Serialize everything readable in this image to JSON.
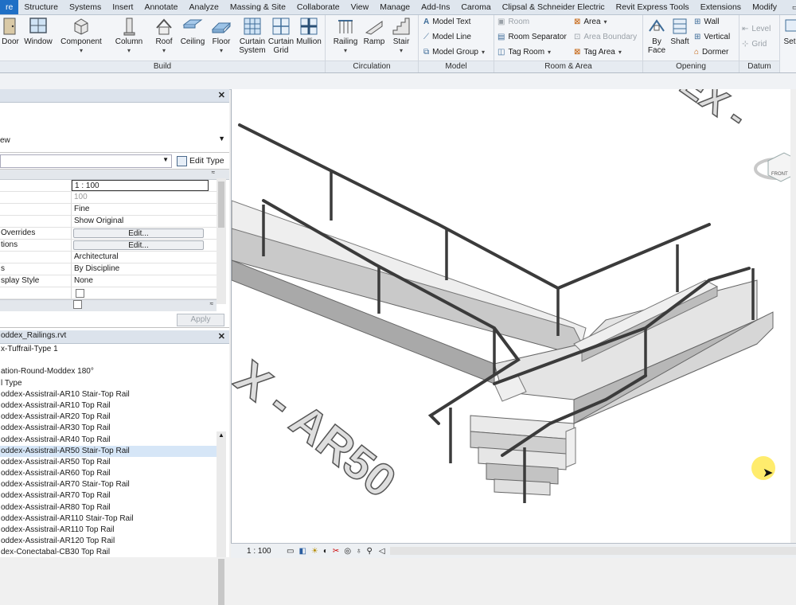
{
  "ribbon_tabs": [
    "re",
    "Structure",
    "Systems",
    "Insert",
    "Annotate",
    "Analyze",
    "Massing & Site",
    "Collaborate",
    "View",
    "Manage",
    "Add-Ins",
    "Caroma",
    "Clipsal & Schneider Electric",
    "Revit Express Tools",
    "Extensions",
    "Modify"
  ],
  "active_tab_index": 0,
  "build": {
    "title": "Build",
    "tools": [
      {
        "label": "Door",
        "icon": "door-icon"
      },
      {
        "label": "Window",
        "icon": "window-icon"
      },
      {
        "label": "Component",
        "icon": "component-icon"
      },
      {
        "label": "Column",
        "icon": "column-icon"
      },
      {
        "label": "Roof",
        "icon": "roof-icon"
      },
      {
        "label": "Ceiling",
        "icon": "ceiling-icon"
      },
      {
        "label": "Floor",
        "icon": "floor-icon"
      },
      {
        "label": "Curtain System",
        "icon": "curtain-system-icon"
      },
      {
        "label": "Curtain Grid",
        "icon": "curtain-grid-icon"
      },
      {
        "label": "Mullion",
        "icon": "mullion-icon"
      }
    ]
  },
  "circulation": {
    "title": "Circulation",
    "tools": [
      {
        "label": "Railing"
      },
      {
        "label": "Ramp"
      },
      {
        "label": "Stair"
      }
    ]
  },
  "model": {
    "title": "Model",
    "tools": [
      {
        "label": "Model Text"
      },
      {
        "label": "Model Line"
      },
      {
        "label": "Model Group"
      }
    ]
  },
  "room_area": {
    "title": "Room & Area",
    "tools": [
      {
        "label": "Room",
        "disabled": true
      },
      {
        "label": "Room Separator",
        "disabled": false
      },
      {
        "label": "Tag Room",
        "disabled": false
      },
      {
        "label": "Area",
        "disabled": false
      },
      {
        "label": "Area Boundary",
        "disabled": true
      },
      {
        "label": "Tag Area",
        "disabled": false
      }
    ]
  },
  "opening": {
    "title": "Opening",
    "tools": [
      {
        "label": "By Face"
      },
      {
        "label": "Shaft"
      },
      {
        "label": "Wall"
      },
      {
        "label": "Vertical"
      },
      {
        "label": "Dormer"
      }
    ]
  },
  "datum": {
    "title": "Datum",
    "tools": [
      {
        "label": "Level",
        "disabled": true
      },
      {
        "label": "Grid",
        "disabled": true
      }
    ]
  },
  "work_plane": {
    "label": "Set"
  },
  "properties": {
    "type_text": "ew",
    "edit_type_label": "Edit Type",
    "rows": [
      {
        "name": "",
        "value": "1 : 100",
        "style": "input"
      },
      {
        "name": "",
        "value": "100",
        "style": "grey"
      },
      {
        "name": "",
        "value": "Fine",
        "style": "text"
      },
      {
        "name": "",
        "value": "Show Original",
        "style": "text"
      },
      {
        "name": "Overrides",
        "value": "Edit...",
        "style": "button"
      },
      {
        "name": "tions",
        "value": "Edit...",
        "style": "button"
      },
      {
        "name": "",
        "value": "Architectural",
        "style": "text"
      },
      {
        "name": "s",
        "value": "By Discipline",
        "style": "text"
      },
      {
        "name": "splay Style",
        "value": "None",
        "style": "text"
      },
      {
        "name": "",
        "value": "",
        "style": "checkbox"
      }
    ],
    "apply_label": "Apply"
  },
  "browser": {
    "title": "oddex_Railings.rvt",
    "items": [
      "x-Tuffrail-Type 1",
      "",
      "ation-Round-Moddex 180°",
      "l Type",
      "oddex-Assistrail-AR10 Stair-Top Rail",
      "oddex-Assistrail-AR10 Top Rail",
      "oddex-Assistrail-AR20 Top Rail",
      "oddex-Assistrail-AR30 Top Rail",
      "oddex-Assistrail-AR40 Top Rail",
      "oddex-Assistrail-AR50 Stair-Top Rail",
      "oddex-Assistrail-AR50 Top Rail",
      "oddex-Assistrail-AR60 Top Rail",
      "oddex-Assistrail-AR70 Stair-Top Rail",
      "oddex-Assistrail-AR70 Top Rail",
      "oddex-Assistrail-AR80 Top Rail",
      "oddex-Assistrail-AR110 Stair-Top Rail",
      "oddex-Assistrail-AR110 Top Rail",
      "oddex-Assistrail-AR120 Top Rail",
      "dex-Conectabal-CB30 Top Rail"
    ],
    "selected_index": 9
  },
  "viewport": {
    "labels": [
      "EX -",
      "X - AR50"
    ],
    "viewcube_face": "FRONT"
  },
  "status": {
    "scale": "1 : 100"
  }
}
